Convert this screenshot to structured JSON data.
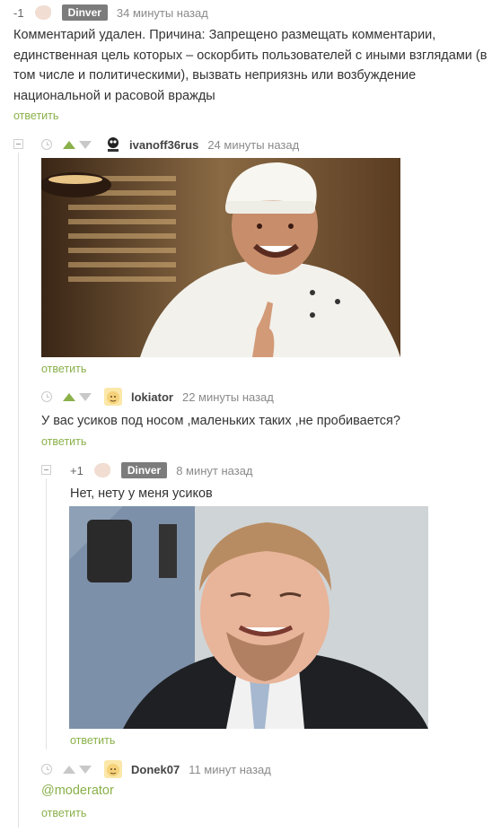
{
  "c1": {
    "rating": "-1",
    "user": "Dinver",
    "time": "34 минуты назад",
    "text": "Комментарий удален. Причина: Запрещено размещать комментарии, единственная цель которых – оскорбить пользователей с иными взглядами (в том числе и политическими), вызвать неприязнь или возбуждение национальной и расовой вражды",
    "reply": "ответить"
  },
  "c2": {
    "user": "ivanoff36rus",
    "time": "24 минуты назад",
    "reply": "ответить"
  },
  "c3": {
    "user": "lokiator",
    "time": "22 минуты назад",
    "text": "У вас усиков под носом ,маленьких таких ,не пробивается?",
    "reply": "ответить"
  },
  "c4": {
    "rating": "+1",
    "user": "Dinver",
    "time": "8 минут назад",
    "text": "Нет, нету у меня усиков",
    "reply": "ответить"
  },
  "c5": {
    "user": "Donek07",
    "time": "11 минут назад",
    "text": "@moderator",
    "reply": "ответить"
  },
  "colors": {
    "accent": "#8ab14a",
    "badge": "#7c7c7c",
    "vote_inactive": "#c8c8c8"
  },
  "icons": [
    "clock-icon",
    "upvote-arrow-icon",
    "downvote-arrow-icon",
    "collapse-icon",
    "avatar"
  ]
}
